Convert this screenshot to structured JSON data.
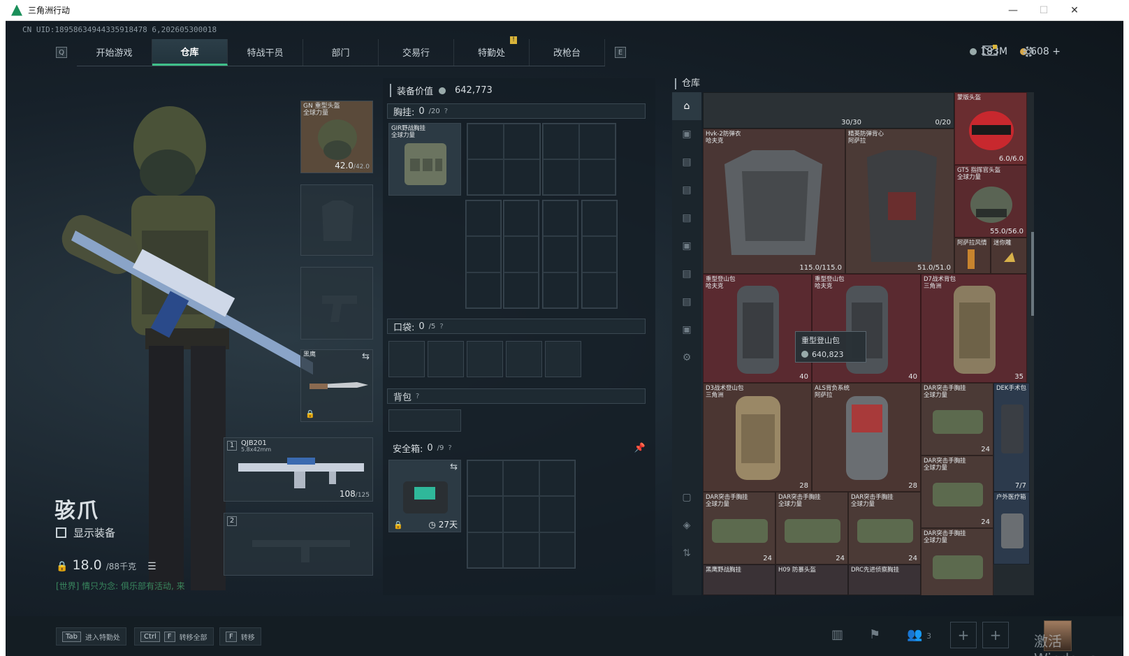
{
  "window": {
    "title": "三角洲行动",
    "controls": [
      "—",
      "☐",
      "✕"
    ]
  },
  "uid": "CN UID:18958634944335918478 6,202605300018",
  "nav": {
    "left_key": "Q",
    "right_key": "E",
    "tabs": [
      "开始游戏",
      "仓库",
      "特战干员",
      "部门",
      "交易行",
      "特勤处",
      "改枪台"
    ],
    "active_tab": "仓库",
    "alert_badge": "!"
  },
  "currency": {
    "silver": "183M",
    "gold": "608",
    "gold_add": "+"
  },
  "character": {
    "name": "骇爪",
    "show_gear_label": "显示装备",
    "weight": "18.0",
    "weight_max": "/88千克",
    "chat": "[世界] 情只为念: 俱乐部有活动, 来"
  },
  "equip_slots": {
    "helmet": {
      "label": "GN 重型头盔\n全球力量",
      "value": "42.0",
      "max": "/42.0"
    },
    "melee": {
      "label": "黑鹰"
    },
    "primary": {
      "index": "1",
      "label": "QJB201",
      "sub": "5.8x42mm",
      "ammo": "108",
      "ammo_max": "/125"
    },
    "secondary": {
      "index": "2"
    }
  },
  "loadout": {
    "value_label": "装备价值",
    "value": "642,773",
    "chest": {
      "label": "胸挂:",
      "count": "0",
      "max": "/20",
      "help": "?",
      "item": "GIR野战胸挂\n全球力量"
    },
    "pocket": {
      "label": "口袋:",
      "count": "0",
      "max": "/5",
      "help": "?"
    },
    "backpack": {
      "label": "背包",
      "help": "?"
    },
    "safe": {
      "label": "安全箱:",
      "count": "0",
      "max": "/9",
      "help": "?",
      "duration": "27天"
    }
  },
  "warehouse": {
    "title": "仓库",
    "top_counts": [
      "30/30",
      "0/20"
    ],
    "items": [
      {
        "name": "Hvk-2防弹衣\n哈夫克",
        "count": "115.0/115.0"
      },
      {
        "name": "精英防弹背心\n阿萨拉",
        "count": "51.0/51.0"
      },
      {
        "name": "蒙版头盔",
        "count": "6.0/6.0"
      },
      {
        "name": "GT5 指挥官头盔\n全球力量",
        "count": "55.0/56.0"
      },
      {
        "name": "阿萨拉风情",
        "count": ""
      },
      {
        "name": "迷你雕",
        "count": ""
      },
      {
        "name": "重型登山包\n哈夫克",
        "count": "40"
      },
      {
        "name": "重型登山包\n哈夫克",
        "count": "40"
      },
      {
        "name": "D7战术背包\n三角洲",
        "count": "35"
      },
      {
        "name": "D3战术登山包\n三角洲",
        "count": "28"
      },
      {
        "name": "ALS背负系统\n阿萨拉",
        "count": "28"
      },
      {
        "name": "DAR突击手胸挂\n全球力量",
        "count": "24"
      },
      {
        "name": "DEK手术包",
        "count": "7/7"
      },
      {
        "name": "DAR突击手胸挂\n全球力量",
        "count": "24"
      },
      {
        "name": "户外医疗箱",
        "count": ""
      },
      {
        "name": "DAR突击手胸挂\n全球力量",
        "count": "24"
      },
      {
        "name": "DAR突击手胸挂\n全球力量",
        "count": "24"
      },
      {
        "name": "DAR突击手胸挂\n全球力量",
        "count": "24"
      },
      {
        "name": "DAR突击手胸挂\n全球力量",
        "count": ""
      },
      {
        "name": "黑鹰野战胸挂",
        "count": ""
      },
      {
        "name": "H09 防暴头盔",
        "count": ""
      },
      {
        "name": "DRC先进侦察胸挂",
        "count": ""
      }
    ],
    "tooltip": {
      "name": "重型登山包",
      "value": "640,823"
    }
  },
  "bottom": {
    "hints": [
      {
        "keys": [
          "Tab"
        ],
        "label": "进入特勤处"
      },
      {
        "keys": [
          "Ctrl",
          "F"
        ],
        "label": "转移全部"
      },
      {
        "keys": [
          "F"
        ],
        "label": "转移"
      }
    ],
    "team_count": "3",
    "watermark": "激活 Windows"
  }
}
